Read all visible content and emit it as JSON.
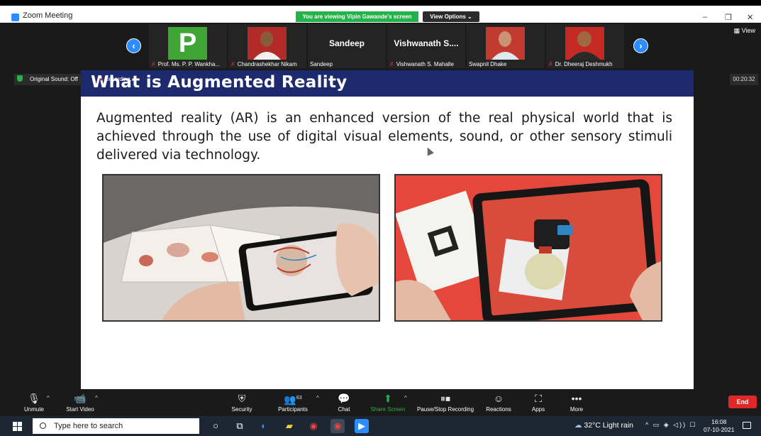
{
  "window": {
    "title": "Zoom Meeting",
    "viewing_banner": "You are viewing Vipin Gawande's screen",
    "view_options": "View Options ⌄",
    "minimize": "–",
    "maximize": "❐",
    "close": "✕"
  },
  "strip": {
    "prev_arrow": "‹",
    "next_arrow": "›",
    "view_label": "▦ View",
    "tiles": [
      {
        "caption": "Prof. Ms. P. P. Wankha...",
        "letter": "P"
      },
      {
        "caption": "Chandrashekhar Nikam"
      },
      {
        "caption": "Sandeep",
        "big_name": "Sandeep"
      },
      {
        "caption": "Vishwanath S. Mahalle",
        "big_name": "Vishwanath  S...."
      },
      {
        "caption": "Swapnil Dhake"
      },
      {
        "caption": "Dr. Dheeraj Deshmukh"
      }
    ]
  },
  "share": {
    "original_sound": "Original Sound: Off",
    "recording": "Recording...",
    "timer": "00:20:32"
  },
  "slide": {
    "title": "What is Augmented Reality",
    "body": "Augmented reality (AR) is an enhanced version of the real physical world that is achieved through the use of digital visual elements, sound, or other sensory stimuli delivered via technology."
  },
  "controls": {
    "unmute": "Unmute",
    "start_video": "Start Video",
    "security": "Security",
    "participants": "Participants",
    "participants_count": "63",
    "chat": "Chat",
    "share_screen": "Share Screen",
    "pause_recording": "Pause/Stop Recording",
    "reactions": "Reactions",
    "apps": "Apps",
    "more": "More",
    "end": "End"
  },
  "taskbar": {
    "search_placeholder": "Type here to search",
    "weather": "32°C  Light rain",
    "tray": "^ ▭ ◈ ◁)) ☐",
    "time": "16:08",
    "date": "07-10-2021"
  },
  "colors": {
    "zoom_blue": "#2d8cff",
    "banner_green": "#24b24a",
    "slide_header": "#1d2a6e",
    "end_red": "#e02828"
  }
}
